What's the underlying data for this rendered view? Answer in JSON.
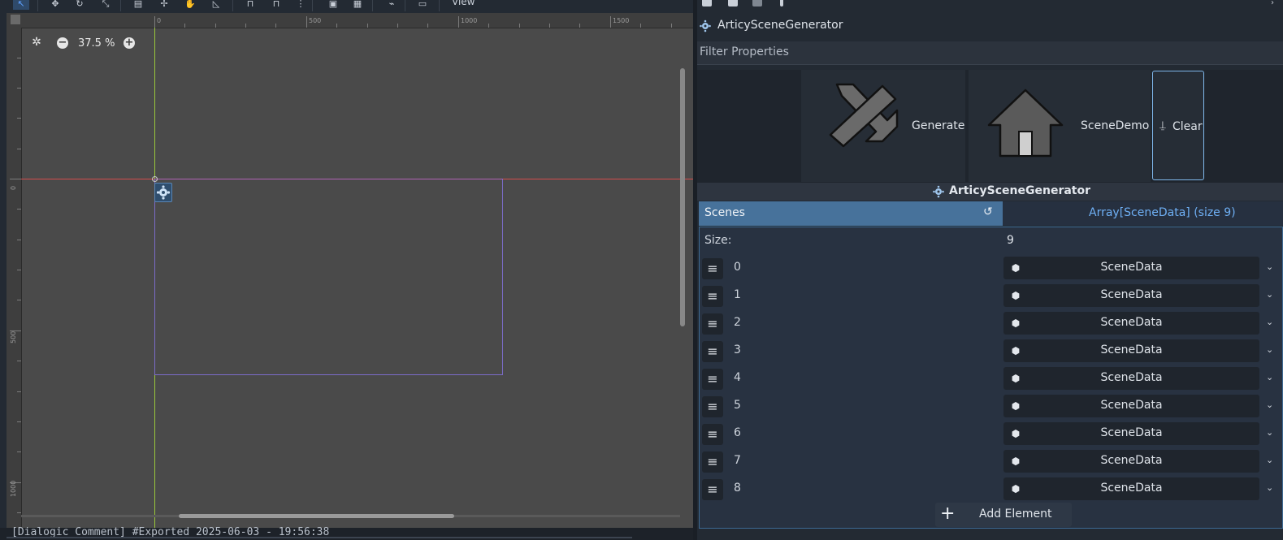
{
  "toolbar": {
    "view_menu": "View"
  },
  "viewport": {
    "zoom": "37.5 %",
    "ruler_top_labels": [
      "0",
      "500",
      "1000",
      "1500"
    ],
    "ruler_left_labels": [
      "0",
      "500",
      "1000"
    ],
    "colors": {
      "x_axis": "#d54c4c",
      "y_axis": "#9bc73a",
      "frame": "#7b6cc9"
    }
  },
  "status": {
    "text": "[Dialogic Comment] #Exported 2025-06-03 - 19:56:38"
  },
  "inspector": {
    "object_name": "ArticySceneGenerator",
    "filter_placeholder": "Filter Properties",
    "buttons": {
      "generate": "Generate",
      "scene_demo": "SceneDemo",
      "clear": "Clear"
    },
    "section_title": "ArticySceneGenerator",
    "property": {
      "name": "Scenes",
      "summary": "Array[SceneData] (size 9)",
      "size_label": "Size:",
      "size_value": "9",
      "items": [
        {
          "index": "0",
          "value": "SceneData"
        },
        {
          "index": "1",
          "value": "SceneData"
        },
        {
          "index": "2",
          "value": "SceneData"
        },
        {
          "index": "3",
          "value": "SceneData"
        },
        {
          "index": "4",
          "value": "SceneData"
        },
        {
          "index": "5",
          "value": "SceneData"
        },
        {
          "index": "6",
          "value": "SceneData"
        },
        {
          "index": "7",
          "value": "SceneData"
        },
        {
          "index": "8",
          "value": "SceneData"
        }
      ],
      "add_label": "Add Element"
    },
    "colors": {
      "accent": "#6fb0f5",
      "selected_row": "#47729b"
    }
  }
}
